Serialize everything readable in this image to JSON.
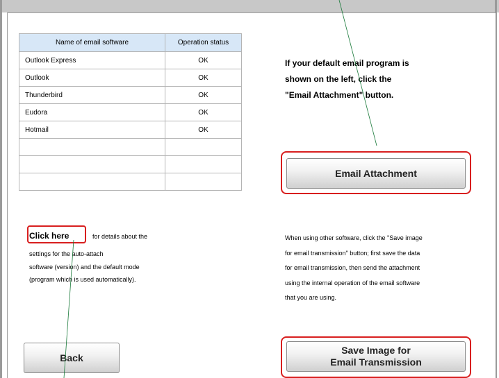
{
  "table": {
    "headers": [
      "Name of email software",
      "Operation status"
    ],
    "rows": [
      [
        "Outlook Express",
        "OK"
      ],
      [
        "Outlook",
        "OK"
      ],
      [
        "Thunderbird",
        "OK"
      ],
      [
        "Eudora",
        "OK"
      ],
      [
        "Hotmail",
        "OK"
      ],
      [
        "",
        ""
      ],
      [
        "",
        ""
      ],
      [
        "",
        ""
      ]
    ]
  },
  "instruction": {
    "line1": "If your default email program is",
    "line2": "shown on the left, click the",
    "line3": "\"Email Attachment\" button."
  },
  "buttons": {
    "email_attachment": "Email Attachment",
    "save_image_line1": "Save Image for",
    "save_image_line2": "Email Transmission",
    "back": "Back"
  },
  "details": {
    "link": "Click here",
    "lead": "for details about the",
    "line1": "settings for the auto-attach",
    "line2": "software (version) and the default mode",
    "line3": "(program which is used automatically)."
  },
  "other_software": {
    "line1": "When using other software, click the \"Save image",
    "line2": "for email transmission\" button; first save the data",
    "line3": "for email transmission, then send the attachment",
    "line4": "using the internal operation of the email software",
    "line5": "that you are using."
  },
  "colors": {
    "highlight": "#d81e1e",
    "table_header_bg": "#d7e7f7",
    "pointer_line": "#1a7a3a"
  }
}
